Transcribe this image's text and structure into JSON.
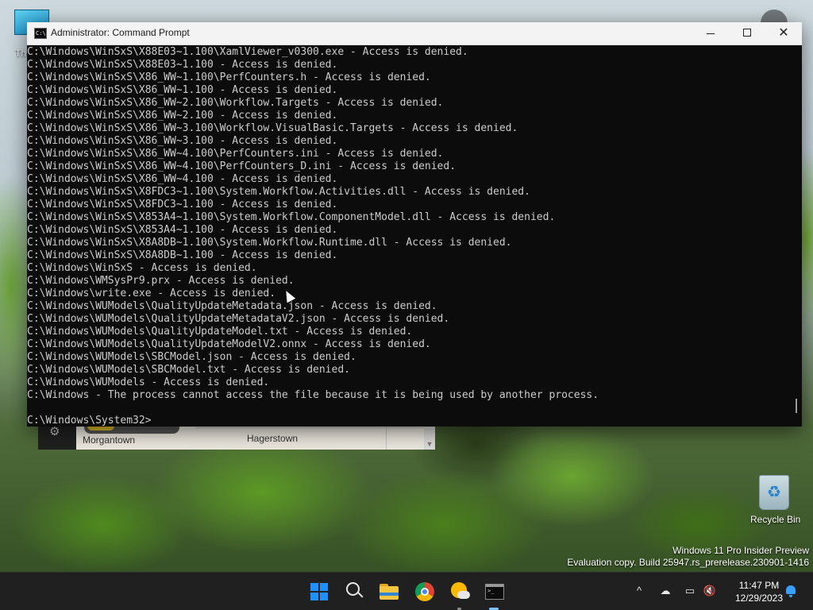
{
  "desktop": {
    "icons": [
      {
        "label": "Th"
      },
      {
        "label": "Recycle Bin"
      }
    ],
    "watermark": {
      "line1": "Windows 11 Pro Insider Preview",
      "line2": "Evaluation copy. Build 25947.rs_prerelease.230901-1416"
    }
  },
  "background_window": {
    "map_labels": [
      "Morgantown",
      "Hagerstown"
    ]
  },
  "cmd_window": {
    "title": "Administrator: Command Prompt",
    "app_icon_text": "C:\\",
    "output_lines": [
      "C:\\Windows\\WinSxS\\X88E03~1.100\\XamlViewer_v0300.exe - Access is denied.",
      "C:\\Windows\\WinSxS\\X88E03~1.100 - Access is denied.",
      "C:\\Windows\\WinSxS\\X86_WW~1.100\\PerfCounters.h - Access is denied.",
      "C:\\Windows\\WinSxS\\X86_WW~1.100 - Access is denied.",
      "C:\\Windows\\WinSxS\\X86_WW~2.100\\Workflow.Targets - Access is denied.",
      "C:\\Windows\\WinSxS\\X86_WW~2.100 - Access is denied.",
      "C:\\Windows\\WinSxS\\X86_WW~3.100\\Workflow.VisualBasic.Targets - Access is denied.",
      "C:\\Windows\\WinSxS\\X86_WW~3.100 - Access is denied.",
      "C:\\Windows\\WinSxS\\X86_WW~4.100\\PerfCounters.ini - Access is denied.",
      "C:\\Windows\\WinSxS\\X86_WW~4.100\\PerfCounters_D.ini - Access is denied.",
      "C:\\Windows\\WinSxS\\X86_WW~4.100 - Access is denied.",
      "C:\\Windows\\WinSxS\\X8FDC3~1.100\\System.Workflow.Activities.dll - Access is denied.",
      "C:\\Windows\\WinSxS\\X8FDC3~1.100 - Access is denied.",
      "C:\\Windows\\WinSxS\\X853A4~1.100\\System.Workflow.ComponentModel.dll - Access is denied.",
      "C:\\Windows\\WinSxS\\X853A4~1.100 - Access is denied.",
      "C:\\Windows\\WinSxS\\X8A8DB~1.100\\System.Workflow.Runtime.dll - Access is denied.",
      "C:\\Windows\\WinSxS\\X8A8DB~1.100 - Access is denied.",
      "C:\\Windows\\WinSxS - Access is denied.",
      "C:\\Windows\\WMSysPr9.prx - Access is denied.",
      "C:\\Windows\\write.exe - Access is denied.",
      "C:\\Windows\\WUModels\\QualityUpdateMetadata.json - Access is denied.",
      "C:\\Windows\\WUModels\\QualityUpdateMetadataV2.json - Access is denied.",
      "C:\\Windows\\WUModels\\QualityUpdateModel.txt - Access is denied.",
      "C:\\Windows\\WUModels\\QualityUpdateModelV2.onnx - Access is denied.",
      "C:\\Windows\\WUModels\\SBCModel.json - Access is denied.",
      "C:\\Windows\\WUModels\\SBCModel.txt - Access is denied.",
      "C:\\Windows\\WUModels - Access is denied.",
      "C:\\Windows - The process cannot access the file because it is being used by another process."
    ],
    "prompt": "C:\\Windows\\System32>"
  },
  "taskbar": {
    "items": [
      "start-icon",
      "search-icon",
      "file-explorer-icon",
      "chrome-icon",
      "weather-icon",
      "terminal-icon"
    ],
    "tray": {
      "glyphs": [
        "^",
        "☁",
        "▭",
        "🔇"
      ]
    },
    "clock": {
      "time": "11:47 PM",
      "date": "12/29/2023"
    }
  },
  "colors": {
    "console_bg": "#0c0c0c",
    "console_fg": "#cccccc",
    "taskbar_bg": "#202020",
    "accent": "#1e90ff"
  }
}
